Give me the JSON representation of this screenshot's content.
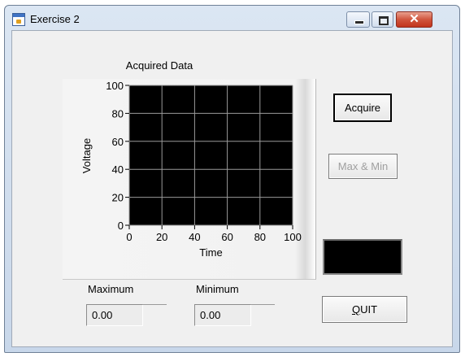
{
  "window": {
    "title": "Exercise 2",
    "controls": {
      "minimize": "minimize-icon",
      "maximize": "maximize-icon",
      "close": "✕"
    }
  },
  "graph": {
    "title": "Acquired Data",
    "ylabel": "Voltage",
    "xlabel": "Time",
    "plot_background": "#000000",
    "grid_color": "#9a9a9a"
  },
  "chart_data": {
    "type": "line",
    "title": "Acquired Data",
    "xlabel": "Time",
    "ylabel": "Voltage",
    "xlim": [
      0,
      100
    ],
    "ylim": [
      0,
      100
    ],
    "x_ticks": [
      0,
      20,
      40,
      60,
      80,
      100
    ],
    "y_ticks": [
      0,
      20,
      40,
      60,
      80,
      100
    ],
    "grid": true,
    "series": []
  },
  "buttons": {
    "acquire": "Acquire",
    "maxmin": "Max & Min",
    "quit": "QUIT"
  },
  "quit_mnemonic": "Q",
  "quit_rest": "UIT",
  "readouts": {
    "maximum_label": "Maximum",
    "maximum_value": "0.00",
    "minimum_label": "Minimum",
    "minimum_value": "0.00"
  },
  "indicator": {
    "color": "#000000",
    "state": "off"
  }
}
